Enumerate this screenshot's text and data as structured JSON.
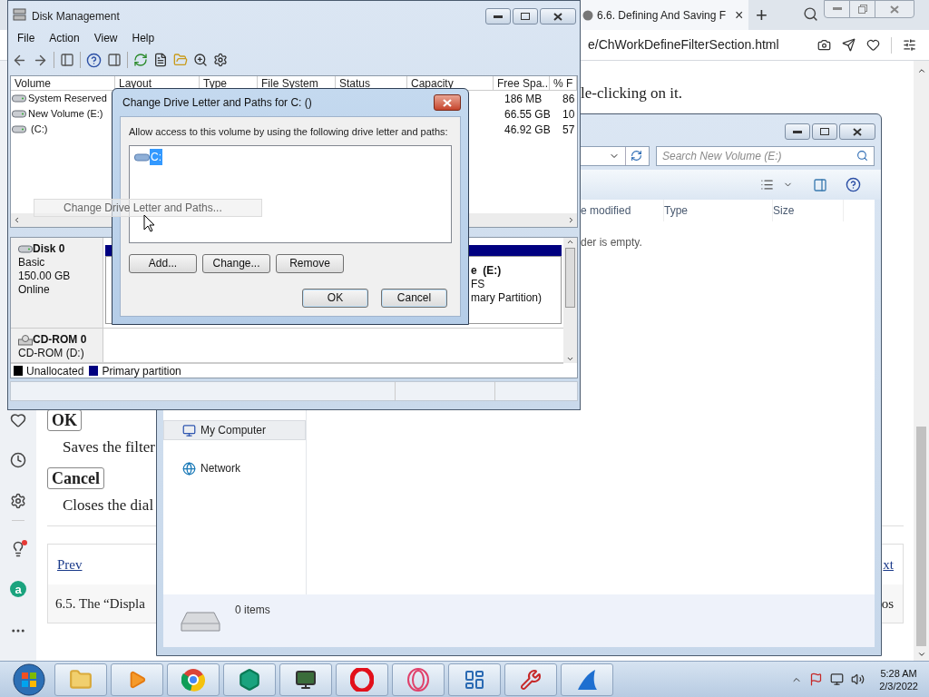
{
  "browser": {
    "tab": {
      "title": "6.6. Defining And Saving F",
      "close": "×"
    },
    "new_tab": "+",
    "address": "e/ChWorkDefineFilterSection.html",
    "sidebar_badge": "a",
    "article": {
      "intro": "le-clicking on it.",
      "terms": [
        {
          "term": "OK",
          "description": "Saves the filter"
        },
        {
          "term": "Cancel",
          "description": "Closes the dial"
        }
      ],
      "nav": {
        "prev": "Prev",
        "next": "xt",
        "prev_title": "6.5. The “Displa",
        "next_title": "os"
      }
    }
  },
  "explorer": {
    "search": {
      "placeholder": "Search New Volume (E:)"
    },
    "columns": [
      "e modified",
      "Type",
      "Size"
    ],
    "empty_message": "der is empty.",
    "navigation": [
      {
        "label": "My Computer",
        "kind": "computer",
        "selected": true
      },
      {
        "label": "Network",
        "kind": "network",
        "selected": false
      }
    ],
    "details": "0 items"
  },
  "disk_management": {
    "title": "Disk Management",
    "menu": [
      "File",
      "Action",
      "View",
      "Help"
    ],
    "columns": [
      "Volume",
      "Layout",
      "Type",
      "File System",
      "Status",
      "Capacity",
      "Free Spa...",
      "% F"
    ],
    "volumes": [
      {
        "name": "System Reserved",
        "free": "186 MB",
        "percent": "86"
      },
      {
        "name": "New Volume (E:)",
        "free": "66.55 GB",
        "percent": "10"
      },
      {
        "name": " (C:)",
        "free": "46.92 GB",
        "percent": "57"
      }
    ],
    "context_item": "Change Drive Letter and Paths...",
    "disks": [
      {
        "name": "Disk 0",
        "kind": "disk",
        "details": [
          "Basic",
          "150.00 GB",
          "Online"
        ]
      },
      {
        "name": "CD-ROM 0",
        "kind": "cdrom",
        "details": [
          "CD-ROM (D:)"
        ]
      }
    ],
    "partition": {
      "name": "e  (E:)",
      "lines": [
        "FS",
        "mary Partition)"
      ]
    },
    "legend": [
      {
        "label": "Unallocated",
        "color": "#000000"
      },
      {
        "label": "Primary partition",
        "color": "#000080"
      }
    ]
  },
  "dialog": {
    "title": "Change Drive Letter and Paths for C: ()",
    "prompt": "Allow access to this volume by using the following drive letter and paths:",
    "entries": [
      {
        "label": "C:",
        "selected": true
      }
    ],
    "actions": [
      "Add...",
      "Change...",
      "Remove"
    ],
    "confirm": [
      "OK",
      "Cancel"
    ]
  },
  "taskbar": {
    "time": "5:28 AM",
    "date": "2/3/2022"
  }
}
